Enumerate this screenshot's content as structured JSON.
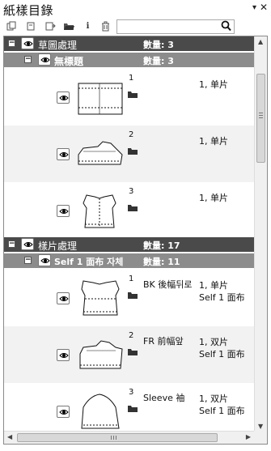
{
  "window": {
    "title": "紙樣目錄",
    "pin_glyph": "▾",
    "close_glyph": "✕"
  },
  "toolbar": {
    "icons": [
      "copy-icon",
      "duplicate-icon",
      "duplicate-to-icon",
      "folder-open-icon",
      "info-icon",
      "trash-icon"
    ],
    "info_glyph": "i",
    "search_value": "",
    "search_placeholder": ""
  },
  "groups": [
    {
      "name": "草圖處理",
      "count_label": "數量: 3",
      "subgroups": [
        {
          "name": "無標題",
          "count_label": "數量: 3",
          "pieces": [
            {
              "num": "1",
              "name": "",
              "info1": "1, 单片",
              "info2": ""
            },
            {
              "num": "2",
              "name": "",
              "info1": "1, 单片",
              "info2": ""
            },
            {
              "num": "3",
              "name": "",
              "info1": "1, 单片",
              "info2": ""
            }
          ]
        }
      ]
    },
    {
      "name": "樣片處理",
      "count_label": "數量: 17",
      "subgroups": [
        {
          "name": "Self 1 面布 자체",
          "count_label": "數量: 11",
          "pieces": [
            {
              "num": "1",
              "name": "BK 後幅뒤로",
              "info1": "1, 单片",
              "info2": "Self 1 面布"
            },
            {
              "num": "2",
              "name": "FR 前幅앞",
              "info1": "1, 双片",
              "info2": "Self 1 面布"
            },
            {
              "num": "3",
              "name": "Sleeve 袖",
              "info1": "1, 双片",
              "info2": "Self 1 面布"
            }
          ]
        }
      ]
    }
  ],
  "expand_glyph": "−",
  "scroll": {
    "up": "▲",
    "down": "▼",
    "left": "◀",
    "right": "▶"
  }
}
